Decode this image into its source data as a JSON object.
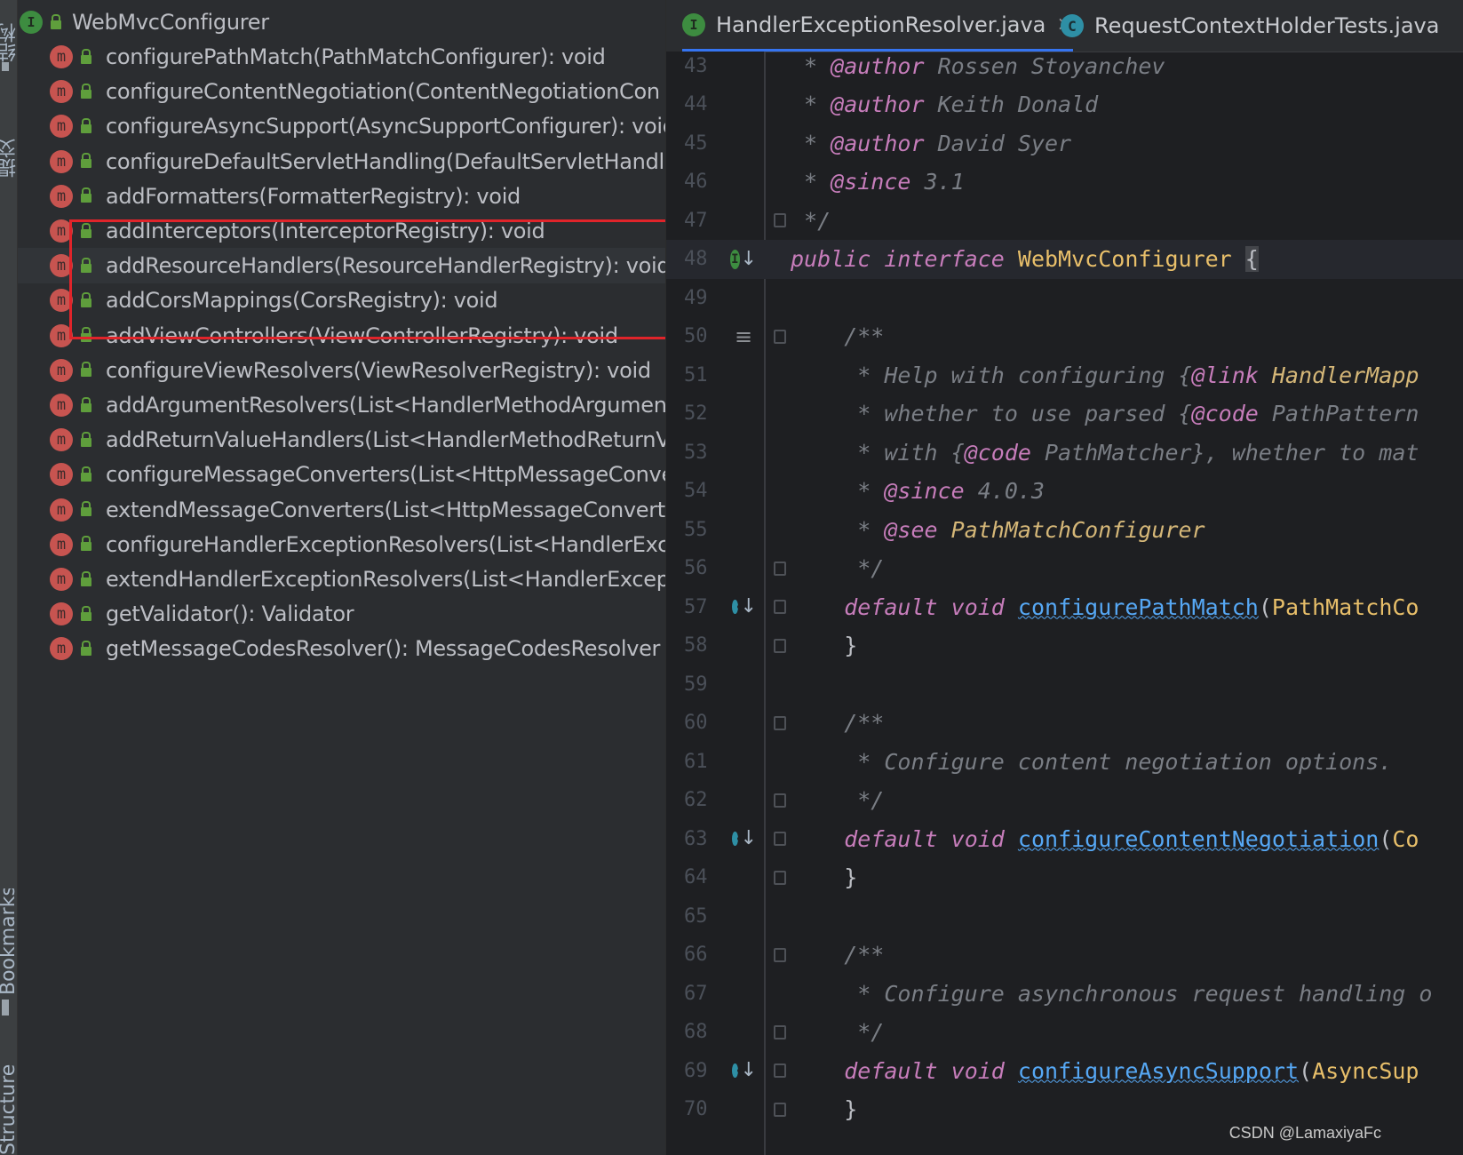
{
  "side_strip": {
    "tabs": [
      "结构",
      "提交",
      "Bookmarks",
      "Structure"
    ]
  },
  "structure": {
    "root": {
      "icon": "interface-icon",
      "badge": "I",
      "label": "WebMvcConfigurer"
    },
    "items": [
      {
        "badge": "m",
        "label": "configurePathMatch(PathMatchConfigurer): void"
      },
      {
        "badge": "m",
        "label": "configureContentNegotiation(ContentNegotiationCon"
      },
      {
        "badge": "m",
        "label": "configureAsyncSupport(AsyncSupportConfigurer): void"
      },
      {
        "badge": "m",
        "label": "configureDefaultServletHandling(DefaultServletHandle"
      },
      {
        "badge": "m",
        "label": "addFormatters(FormatterRegistry): void"
      },
      {
        "badge": "m",
        "label": "addInterceptors(InterceptorRegistry): void"
      },
      {
        "badge": "m",
        "label": "addResourceHandlers(ResourceHandlerRegistry): void"
      },
      {
        "badge": "m",
        "label": "addCorsMappings(CorsRegistry): void"
      },
      {
        "badge": "m",
        "label": "addViewControllers(ViewControllerRegistry): void"
      },
      {
        "badge": "m",
        "label": "configureViewResolvers(ViewResolverRegistry): void"
      },
      {
        "badge": "m",
        "label": "addArgumentResolvers(List<HandlerMethodArgumen"
      },
      {
        "badge": "m",
        "label": "addReturnValueHandlers(List<HandlerMethodReturnV"
      },
      {
        "badge": "m",
        "label": "configureMessageConverters(List<HttpMessageConve"
      },
      {
        "badge": "m",
        "label": "extendMessageConverters(List<HttpMessageConverte"
      },
      {
        "badge": "m",
        "label": "configureHandlerExceptionResolvers(List<HandlerExce"
      },
      {
        "badge": "m",
        "label": "extendHandlerExceptionResolvers(List<HandlerExcept"
      },
      {
        "badge": "m",
        "label": "getValidator(): Validator"
      },
      {
        "badge": "m",
        "label": "getMessageCodesResolver(): MessageCodesResolver"
      }
    ]
  },
  "editor": {
    "tabs": [
      {
        "badge": "I",
        "label": "HandlerExceptionResolver.java",
        "close": "×"
      },
      {
        "badge": "C",
        "label": "RequestContextHolderTests.java"
      }
    ],
    "lines": [
      {
        "n": "43",
        "seg": [
          [
            "c-com",
            " * "
          ],
          [
            "c-tag",
            "@author"
          ],
          [
            "c-com",
            " Rossen Stoyanchev"
          ]
        ]
      },
      {
        "n": "44",
        "seg": [
          [
            "c-com",
            " * "
          ],
          [
            "c-tag",
            "@author"
          ],
          [
            "c-com",
            " Keith Donald"
          ]
        ]
      },
      {
        "n": "45",
        "seg": [
          [
            "c-com",
            " * "
          ],
          [
            "c-tag",
            "@author"
          ],
          [
            "c-com",
            " David Syer"
          ]
        ]
      },
      {
        "n": "46",
        "seg": [
          [
            "c-com",
            " * "
          ],
          [
            "c-tag",
            "@since"
          ],
          [
            "c-com",
            " 3.1"
          ]
        ]
      },
      {
        "n": "47",
        "seg": [
          [
            "c-com",
            " */"
          ]
        ]
      },
      {
        "n": "48",
        "seg": [
          [
            "c-kw2",
            "public"
          ],
          [
            "c-plain",
            " "
          ],
          [
            "c-kw2",
            "interface"
          ],
          [
            "c-plain",
            " "
          ],
          [
            "c-type",
            "WebMvcConfigurer"
          ],
          [
            "c-plain",
            " "
          ],
          [
            "c-brace-hl",
            "{"
          ]
        ]
      },
      {
        "n": "49",
        "seg": []
      },
      {
        "n": "50",
        "seg": [
          [
            "c-com",
            "    /**"
          ]
        ]
      },
      {
        "n": "51",
        "seg": [
          [
            "c-com",
            "     * Help with configuring {"
          ],
          [
            "c-tag",
            "@link"
          ],
          [
            "c-tagref",
            " HandlerMapp"
          ]
        ]
      },
      {
        "n": "52",
        "seg": [
          [
            "c-com",
            "     * whether to use parsed {"
          ],
          [
            "c-tag",
            "@code"
          ],
          [
            "c-com",
            " PathPattern"
          ]
        ]
      },
      {
        "n": "53",
        "seg": [
          [
            "c-com",
            "     * with {"
          ],
          [
            "c-tag",
            "@code"
          ],
          [
            "c-com",
            " PathMatcher}, whether to mat"
          ]
        ]
      },
      {
        "n": "54",
        "seg": [
          [
            "c-com",
            "     * "
          ],
          [
            "c-tag",
            "@since"
          ],
          [
            "c-com",
            " 4.0.3"
          ]
        ]
      },
      {
        "n": "55",
        "seg": [
          [
            "c-com",
            "     * "
          ],
          [
            "c-tag",
            "@see"
          ],
          [
            "c-tagref",
            " PathMatchConfigurer"
          ]
        ]
      },
      {
        "n": "56",
        "seg": [
          [
            "c-com",
            "     */"
          ]
        ]
      },
      {
        "n": "57",
        "seg": [
          [
            "c-plain",
            "    "
          ],
          [
            "c-kw2",
            "default"
          ],
          [
            "c-plain",
            " "
          ],
          [
            "c-kw2",
            "void"
          ],
          [
            "c-plain",
            " "
          ],
          [
            "c-meth",
            "configurePathMatch"
          ],
          [
            "c-plain",
            "("
          ],
          [
            "c-type",
            "PathMatchCo"
          ]
        ]
      },
      {
        "n": "58",
        "seg": [
          [
            "c-plain",
            "    }"
          ]
        ]
      },
      {
        "n": "59",
        "seg": []
      },
      {
        "n": "60",
        "seg": [
          [
            "c-com",
            "    /**"
          ]
        ]
      },
      {
        "n": "61",
        "seg": [
          [
            "c-com",
            "     * Configure content negotiation options."
          ]
        ]
      },
      {
        "n": "62",
        "seg": [
          [
            "c-com",
            "     */"
          ]
        ]
      },
      {
        "n": "63",
        "seg": [
          [
            "c-plain",
            "    "
          ],
          [
            "c-kw2",
            "default"
          ],
          [
            "c-plain",
            " "
          ],
          [
            "c-kw2",
            "void"
          ],
          [
            "c-plain",
            " "
          ],
          [
            "c-meth",
            "configureContentNegotiation"
          ],
          [
            "c-plain",
            "("
          ],
          [
            "c-type",
            "Co"
          ]
        ]
      },
      {
        "n": "64",
        "seg": [
          [
            "c-plain",
            "    }"
          ]
        ]
      },
      {
        "n": "65",
        "seg": []
      },
      {
        "n": "66",
        "seg": [
          [
            "c-com",
            "    /**"
          ]
        ]
      },
      {
        "n": "67",
        "seg": [
          [
            "c-com",
            "     * Configure asynchronous request handling o"
          ]
        ]
      },
      {
        "n": "68",
        "seg": [
          [
            "c-com",
            "     */"
          ]
        ]
      },
      {
        "n": "69",
        "seg": [
          [
            "c-plain",
            "    "
          ],
          [
            "c-kw2",
            "default"
          ],
          [
            "c-plain",
            " "
          ],
          [
            "c-kw2",
            "void"
          ],
          [
            "c-plain",
            " "
          ],
          [
            "c-meth",
            "configureAsyncSupport"
          ],
          [
            "c-plain",
            "("
          ],
          [
            "c-type",
            "AsyncSup"
          ]
        ]
      },
      {
        "n": "70",
        "seg": [
          [
            "c-plain",
            "    }"
          ]
        ]
      }
    ]
  },
  "watermark": "CSDN @LamaxiyaFc",
  "colors": {
    "accent": "#3574f0",
    "highlight_box": "#e0242a",
    "method_badge": "#c75450",
    "interface_badge": "#3d8c40"
  }
}
